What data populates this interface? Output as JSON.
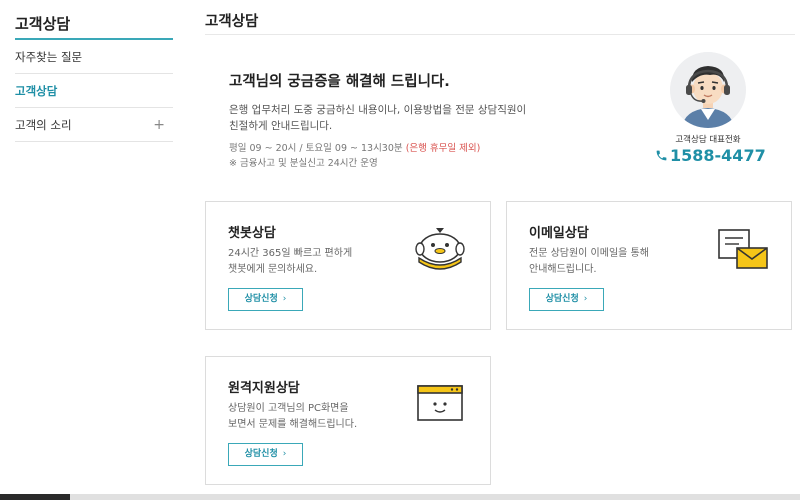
{
  "sidebar": {
    "title": "고객상담",
    "items": [
      {
        "label": "자주찾는 질문"
      },
      {
        "label": "고객상담"
      },
      {
        "label": "고객의 소리",
        "expand_symbol": "+"
      }
    ]
  },
  "page": {
    "title": "고객상담"
  },
  "intro": {
    "heading": "고객님의 궁금증을 해결해 드립니다.",
    "desc_line1": "은행 업무처리 도중 궁금하신 내용이나, 이용방법을 전문 상담직원이",
    "desc_line2": "친절하게 안내드립니다.",
    "hours": "평일 09 ~ 20시 / 토요일 09 ~ 13시30분",
    "hours_note": "(은행 휴무일 제외)",
    "note": "※ 금융사고 및 분실신고 24시간 운영"
  },
  "phone": {
    "label": "고객상담 대표전화",
    "number": "1588-4477"
  },
  "cards": [
    {
      "title": "챗봇상담",
      "desc_line1": "24시간 365일 빠르고 편하게",
      "desc_line2": "챗봇에게 문의하세요.",
      "button": "상담신청",
      "icon": "chatbot-icon"
    },
    {
      "title": "이메일상담",
      "desc_line1": "전문 상담원이 이메일을 통해",
      "desc_line2": "안내해드립니다.",
      "button": "상담신청",
      "icon": "email-icon"
    },
    {
      "title": "원격지원상담",
      "desc_line1": "상담원이 고객님의 PC화면을",
      "desc_line2": "보면서 문제를 해결해드립니다.",
      "button": "상담신청",
      "icon": "remote-support-icon"
    }
  ],
  "colors": {
    "accent": "#1f8fa6",
    "accent_border": "#3aa8b8",
    "warning": "#d9534f",
    "icon_yellow": "#f5c518"
  }
}
